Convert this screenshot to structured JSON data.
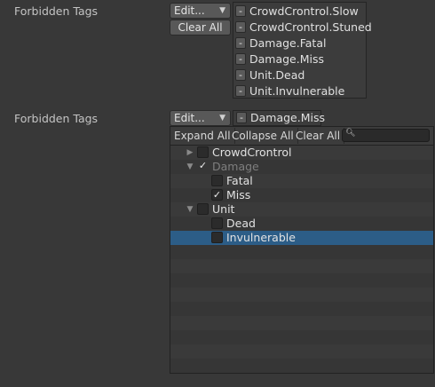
{
  "section1": {
    "label": "Forbidden Tags",
    "dropdown_label": "Edit...",
    "clear_all_label": "Clear All",
    "tags": [
      "CrowdCrontrol.Slow",
      "CrowdCrontrol.Stuned",
      "Damage.Fatal",
      "Damage.Miss",
      "Unit.Dead",
      "Unit.Invulnerable"
    ],
    "remove_glyph": "-"
  },
  "section2": {
    "label": "Forbidden Tags",
    "dropdown_label": "Edit...",
    "selected_tag": "Damage.Miss",
    "remove_glyph": "-"
  },
  "icons": {
    "dropdown_arrow": "▼",
    "expand_closed": "▶",
    "expand_open": "▼",
    "check": "✓",
    "search": "search-icon"
  },
  "tree": {
    "toolbar": {
      "expand_all": "Expand All",
      "collapse_all": "Collapse All",
      "clear_all": "Clear All",
      "search_value": "",
      "search_glyph": "🔍︎"
    },
    "nodes": [
      {
        "label": "CrowdCrontrol",
        "level": 0,
        "foldout": "closed",
        "checked": false,
        "dim": false,
        "selected": false
      },
      {
        "label": "Damage",
        "level": 0,
        "foldout": "open",
        "checked": true,
        "dim": true,
        "selected": false
      },
      {
        "label": "Fatal",
        "level": 1,
        "foldout": "none",
        "checked": false,
        "dim": false,
        "selected": false
      },
      {
        "label": "Miss",
        "level": 1,
        "foldout": "none",
        "checked": true,
        "dim": false,
        "selected": false
      },
      {
        "label": "Unit",
        "level": 0,
        "foldout": "open",
        "checked": false,
        "dim": false,
        "selected": false
      },
      {
        "label": "Dead",
        "level": 1,
        "foldout": "none",
        "checked": false,
        "dim": false,
        "selected": false
      },
      {
        "label": "Invulnerable",
        "level": 1,
        "foldout": "none",
        "checked": false,
        "dim": false,
        "selected": true
      }
    ]
  }
}
